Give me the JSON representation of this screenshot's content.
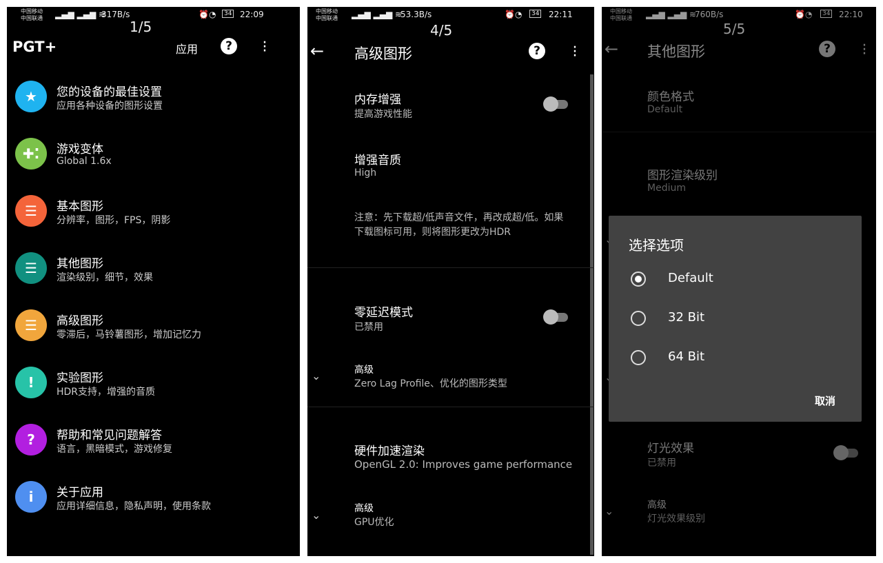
{
  "screens": [
    {
      "status": {
        "carrier1": "中国移动",
        "carrier2": "中国联通",
        "speed": "317B/s",
        "battery": "34",
        "time": "22:09"
      },
      "page": "1/5",
      "title": "PGT+",
      "apply": "应用",
      "items": [
        {
          "title": "您的设备的最佳设置",
          "sub": "应用各种设备的图形设置",
          "icon": "star-icon",
          "color": "#1fb3f0"
        },
        {
          "title": "游戏变体",
          "sub": "Global 1.6x",
          "icon": "gamepad-icon",
          "color": "#7cc24a"
        },
        {
          "title": "基本图形",
          "sub": "分辨率，图形，FPS，阴影",
          "icon": "sliders-icon",
          "color": "#f4643a"
        },
        {
          "title": "其他图形",
          "sub": "渲染级别，细节，效果",
          "icon": "sliders-icon",
          "color": "#119080"
        },
        {
          "title": "高级图形",
          "sub": "零滞后，马铃薯图形，增加记忆力",
          "icon": "sliders-icon",
          "color": "#f1a63c"
        },
        {
          "title": "实验图形",
          "sub": "HDR支持，增强的音质",
          "icon": "alert-badge-icon",
          "color": "#27c3a8"
        },
        {
          "title": "帮助和常见问题解答",
          "sub": "语言，黑暗模式，游戏修复",
          "icon": "help-icon",
          "color": "#b21fe0"
        },
        {
          "title": "关于应用",
          "sub": "应用详细信息，隐私声明，使用条款",
          "icon": "info-icon",
          "color": "#4f8ff0"
        }
      ]
    },
    {
      "status": {
        "carrier1": "中国移动",
        "carrier2": "中国联通",
        "speed": "53.3B/s",
        "battery": "34",
        "time": "22:11"
      },
      "page": "4/5",
      "title": "高级图形",
      "items": [
        {
          "title": "内存增强",
          "sub": "提高游戏性能",
          "toggle": false
        },
        {
          "title": "增强音质",
          "sub": "High"
        },
        {
          "note": "注意：先下载超/低声音文件，再改成超/低。如果下载图标可用，则将图形更改为HDR"
        },
        {
          "title": "零延迟模式",
          "sub": "已禁用",
          "toggle": false
        },
        {
          "title": "高级",
          "sub": "Zero Lag Profile、优化的图形类型"
        },
        {
          "title": "硬件加速渲染",
          "sub": "OpenGL 2.0: Improves game performance"
        },
        {
          "title": "高级",
          "sub": "GPU优化"
        }
      ]
    },
    {
      "status": {
        "carrier1": "中国移动",
        "carrier2": "中国联通",
        "speed": "760B/s",
        "battery": "34",
        "time": "22:10"
      },
      "page": "5/5",
      "title": "其他图形",
      "items": [
        {
          "title": "颜色格式",
          "sub": "Default"
        },
        {
          "title": "图形渲染级别",
          "sub": "Medium"
        },
        {
          "title": "灯光效果",
          "sub": "已禁用",
          "toggle": false
        },
        {
          "title": "高级",
          "sub": "灯光效果级别"
        }
      ],
      "dialog": {
        "title": "选择选项",
        "options": [
          "Default",
          "32 Bit",
          "64 Bit"
        ],
        "selected": "Default",
        "cancel": "取消"
      }
    }
  ]
}
